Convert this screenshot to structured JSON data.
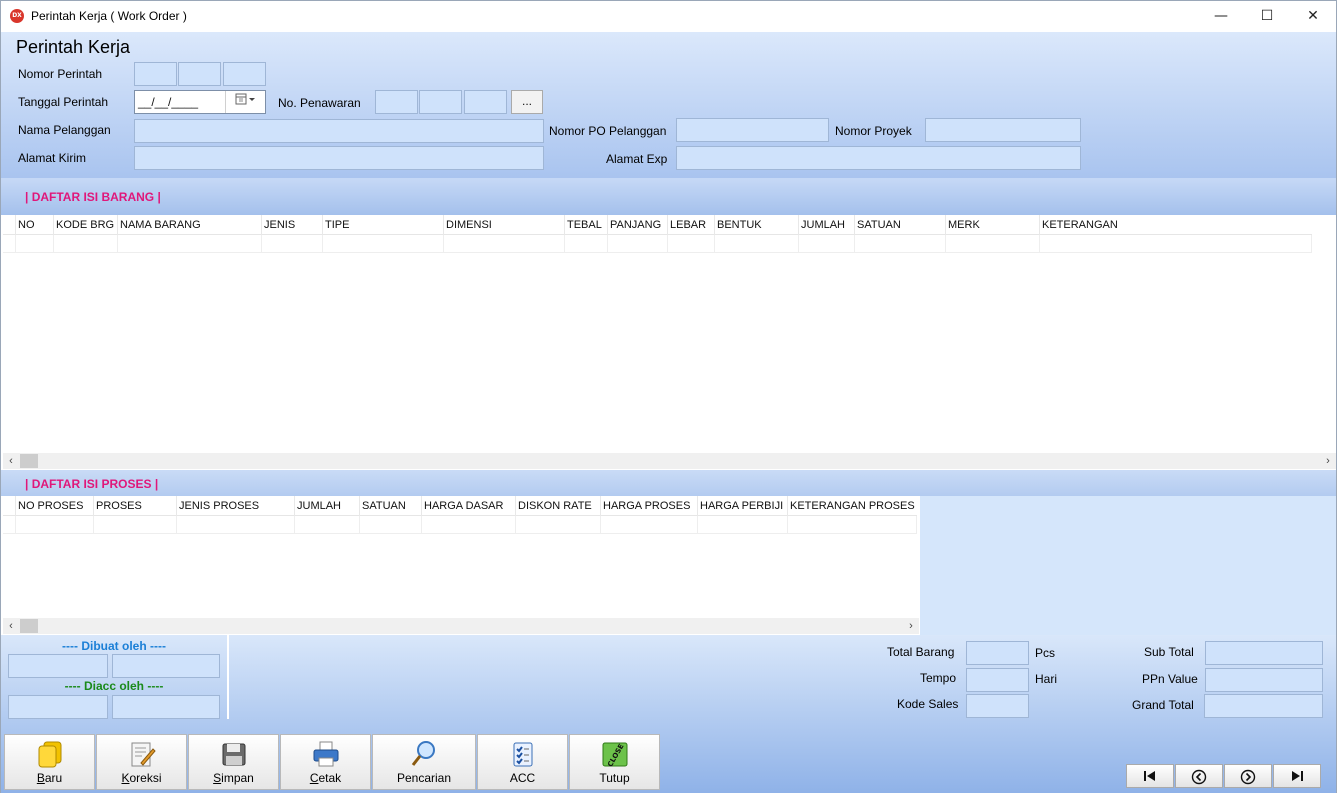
{
  "window": {
    "title": "Perintah Kerja ( Work Order )",
    "app_badge": "DX",
    "controls": {
      "minimize": "—",
      "maximize": "☐",
      "close": "✕"
    }
  },
  "form": {
    "title": "Perintah Kerja",
    "labels": {
      "nomor_perintah": "Nomor Perintah",
      "tanggal_perintah": "Tanggal Perintah",
      "no_penawaran": "No. Penawaran",
      "nama_pelanggan": "Nama Pelanggan",
      "nomor_po_pelanggan": "Nomor PO Pelanggan",
      "nomor_proyek": "Nomor Proyek",
      "alamat_kirim": "Alamat Kirim",
      "alamat_exp": "Alamat Exp"
    },
    "tanggal_value": "__/__/____",
    "browse_label": "..."
  },
  "barang": {
    "section_title": "| DAFTAR ISI BARANG |",
    "columns": [
      "NO",
      "KODE BRG",
      "NAMA BARANG",
      "JENIS",
      "TIPE",
      "DIMENSI",
      "TEBAL",
      "PANJANG",
      "LEBAR",
      "BENTUK",
      "JUMLAH",
      "SATUAN",
      "MERK",
      "KETERANGAN"
    ]
  },
  "proses": {
    "section_title": "| DAFTAR ISI PROSES |",
    "columns": [
      "NO PROSES",
      "PROSES",
      "JENIS PROSES",
      "JUMLAH",
      "SATUAN",
      "HARGA DASAR",
      "DISKON RATE",
      "HARGA PROSES",
      "HARGA PERBIJI",
      "KETERANGAN PROSES"
    ]
  },
  "footer": {
    "dibuat_oleh": "---- Dibuat oleh ----",
    "diacc_oleh": "---- Diacc oleh ----",
    "total_barang": "Total Barang",
    "pcs": "Pcs",
    "tempo": "Tempo",
    "hari": "Hari",
    "kode_sales": "Kode Sales",
    "sub_total": "Sub Total",
    "ppn_value": "PPn Value",
    "grand_total": "Grand Total"
  },
  "toolbar": [
    {
      "label": "Baru",
      "icon": "new-icon"
    },
    {
      "label": "Koreksi",
      "icon": "edit-icon"
    },
    {
      "label": "Simpan",
      "icon": "save-icon"
    },
    {
      "label": "Cetak",
      "icon": "print-icon"
    },
    {
      "label": "Pencarian",
      "icon": "search-icon"
    },
    {
      "label": "ACC",
      "icon": "checklist-icon"
    },
    {
      "label": "Tutup",
      "icon": "close-sign-icon",
      "icon_text": "CLOSE"
    }
  ],
  "colors": {
    "section_title": "#e0177a",
    "dibuat": "#1b7fd6",
    "diacc": "#1a8a1a",
    "input_fill": "#cfe2fb"
  }
}
